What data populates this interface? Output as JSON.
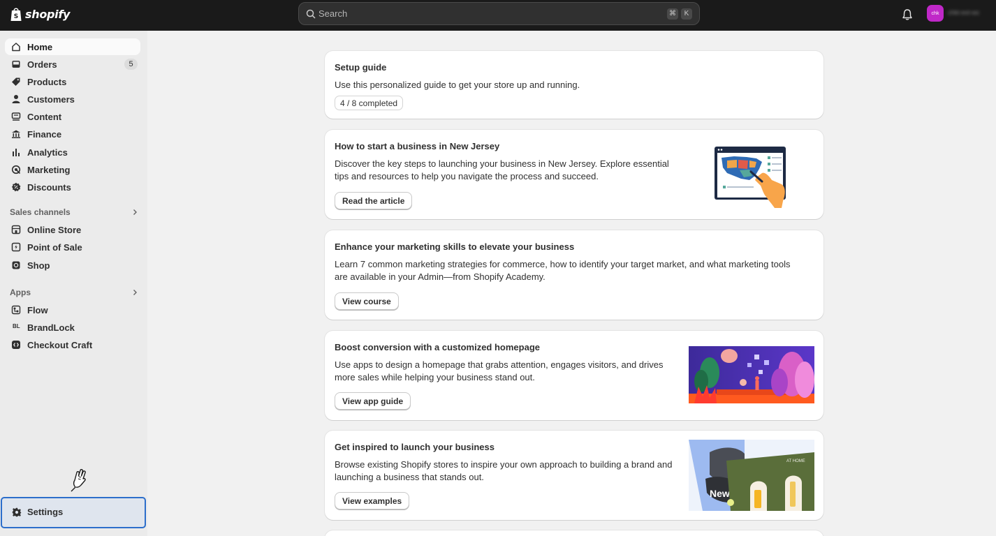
{
  "topbar": {
    "brand": "shopify",
    "search_placeholder": "Search",
    "shortcut_keys": [
      "⌘",
      "K"
    ],
    "avatar_initials": "chk",
    "store_name": "chkt-ext-wc"
  },
  "sidebar": {
    "main_items": [
      {
        "label": "Home",
        "icon": "home-icon",
        "active": true
      },
      {
        "label": "Orders",
        "icon": "orders-icon",
        "badge": "5"
      },
      {
        "label": "Products",
        "icon": "tag-icon"
      },
      {
        "label": "Customers",
        "icon": "person-icon"
      },
      {
        "label": "Content",
        "icon": "content-icon"
      },
      {
        "label": "Finance",
        "icon": "bank-icon"
      },
      {
        "label": "Analytics",
        "icon": "bar-chart-icon"
      },
      {
        "label": "Marketing",
        "icon": "target-icon"
      },
      {
        "label": "Discounts",
        "icon": "discount-icon"
      }
    ],
    "sales_channels_heading": "Sales channels",
    "sales_channels": [
      {
        "label": "Online Store",
        "icon": "storefront-icon"
      },
      {
        "label": "Point of Sale",
        "icon": "pos-icon"
      },
      {
        "label": "Shop",
        "icon": "shop-icon"
      }
    ],
    "apps_heading": "Apps",
    "apps": [
      {
        "label": "Flow",
        "icon": "flow-icon"
      },
      {
        "label": "BrandLock",
        "icon": "brandlock-icon",
        "icon_text": "BL"
      },
      {
        "label": "Checkout Craft",
        "icon": "checkout-craft-icon"
      }
    ],
    "settings_label": "Settings"
  },
  "cards": {
    "setup": {
      "title": "Setup guide",
      "description": "Use this personalized guide to get your store up and running.",
      "progress": "4 / 8 completed"
    },
    "nj": {
      "title": "How to start a business in New Jersey",
      "description": "Discover the key steps to launching your business in New Jersey. Explore essential tips and resources to help you navigate the process and succeed.",
      "button": "Read the article"
    },
    "marketing": {
      "title": "Enhance your marketing skills to elevate your business",
      "description": "Learn 7 common marketing strategies for commerce, how to identify your target market, and what marketing tools are available in your Admin—from Shopify Academy.",
      "button": "View course"
    },
    "homepage": {
      "title": "Boost conversion with a customized homepage",
      "description": "Use apps to design a homepage that grabs attention, engages visitors, and drives more sales while helping your business stand out.",
      "button": "View app guide"
    },
    "inspire": {
      "title": "Get inspired to launch your business",
      "description": "Browse existing Shopify stores to inspire your own approach to building a brand and launching a business that stands out.",
      "button": "View examples",
      "art_text": [
        "New",
        "AT HOME"
      ]
    }
  },
  "colors": {
    "topbar": "#1a1a1a",
    "sidebar": "#ebebeb",
    "page": "#f1f1f1",
    "avatar": "#c028c8",
    "focus_ring": "#2c6ecb"
  }
}
